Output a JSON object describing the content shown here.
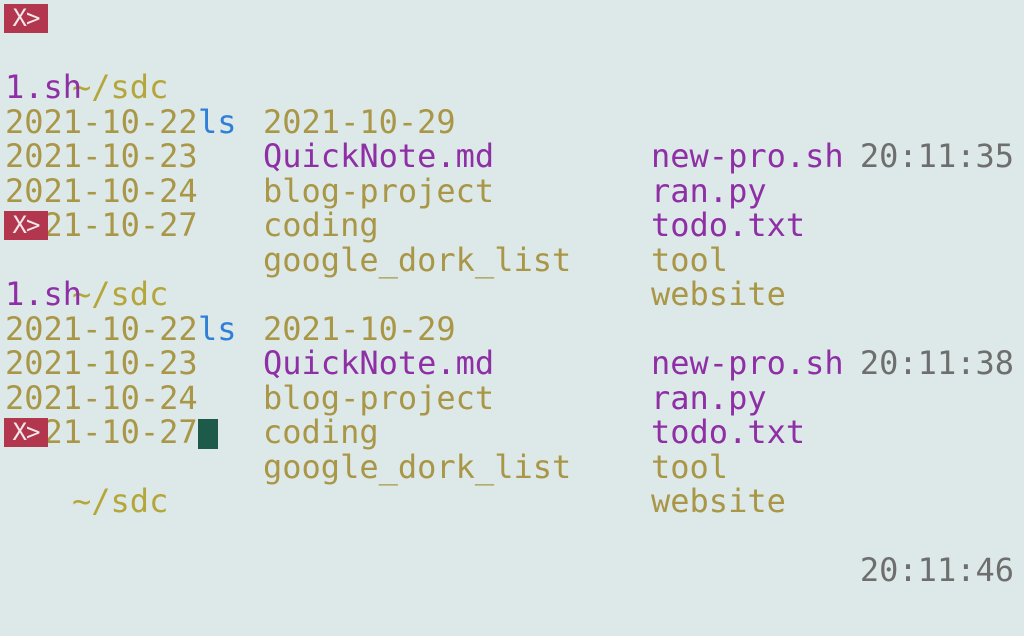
{
  "prompt_badge": "X>",
  "blocks": [
    {
      "path": "~/sdc",
      "command": "ls",
      "time": "20:11:35",
      "rows": [
        [
          "1.sh",
          "2021-10-29",
          "new-pro.sh"
        ],
        [
          "2021-10-22",
          "QuickNote.md",
          "ran.py"
        ],
        [
          "2021-10-23",
          "blog-project",
          "todo.txt"
        ],
        [
          "2021-10-24",
          "coding",
          "tool"
        ],
        [
          "2021-10-27",
          "google_dork_list",
          "website"
        ]
      ]
    },
    {
      "path": "~/sdc",
      "command": "ls",
      "time": "20:11:38",
      "rows": [
        [
          "1.sh",
          "2021-10-29",
          "new-pro.sh"
        ],
        [
          "2021-10-22",
          "QuickNote.md",
          "ran.py"
        ],
        [
          "2021-10-23",
          "blog-project",
          "todo.txt"
        ],
        [
          "2021-10-24",
          "coding",
          "tool"
        ],
        [
          "2021-10-27",
          "google_dork_list",
          "website"
        ]
      ]
    }
  ],
  "current_prompt": {
    "path": "~/sdc",
    "time": "20:11:46"
  },
  "colors": {
    "background": "#dde9e8",
    "badge": "#b3364f",
    "path": "#b5a63a",
    "command": "#2f7fd8",
    "directory": "#a99646",
    "file": "#8f2fa6",
    "clock": "#6e6e6e",
    "cursor": "#1d5a4a"
  }
}
